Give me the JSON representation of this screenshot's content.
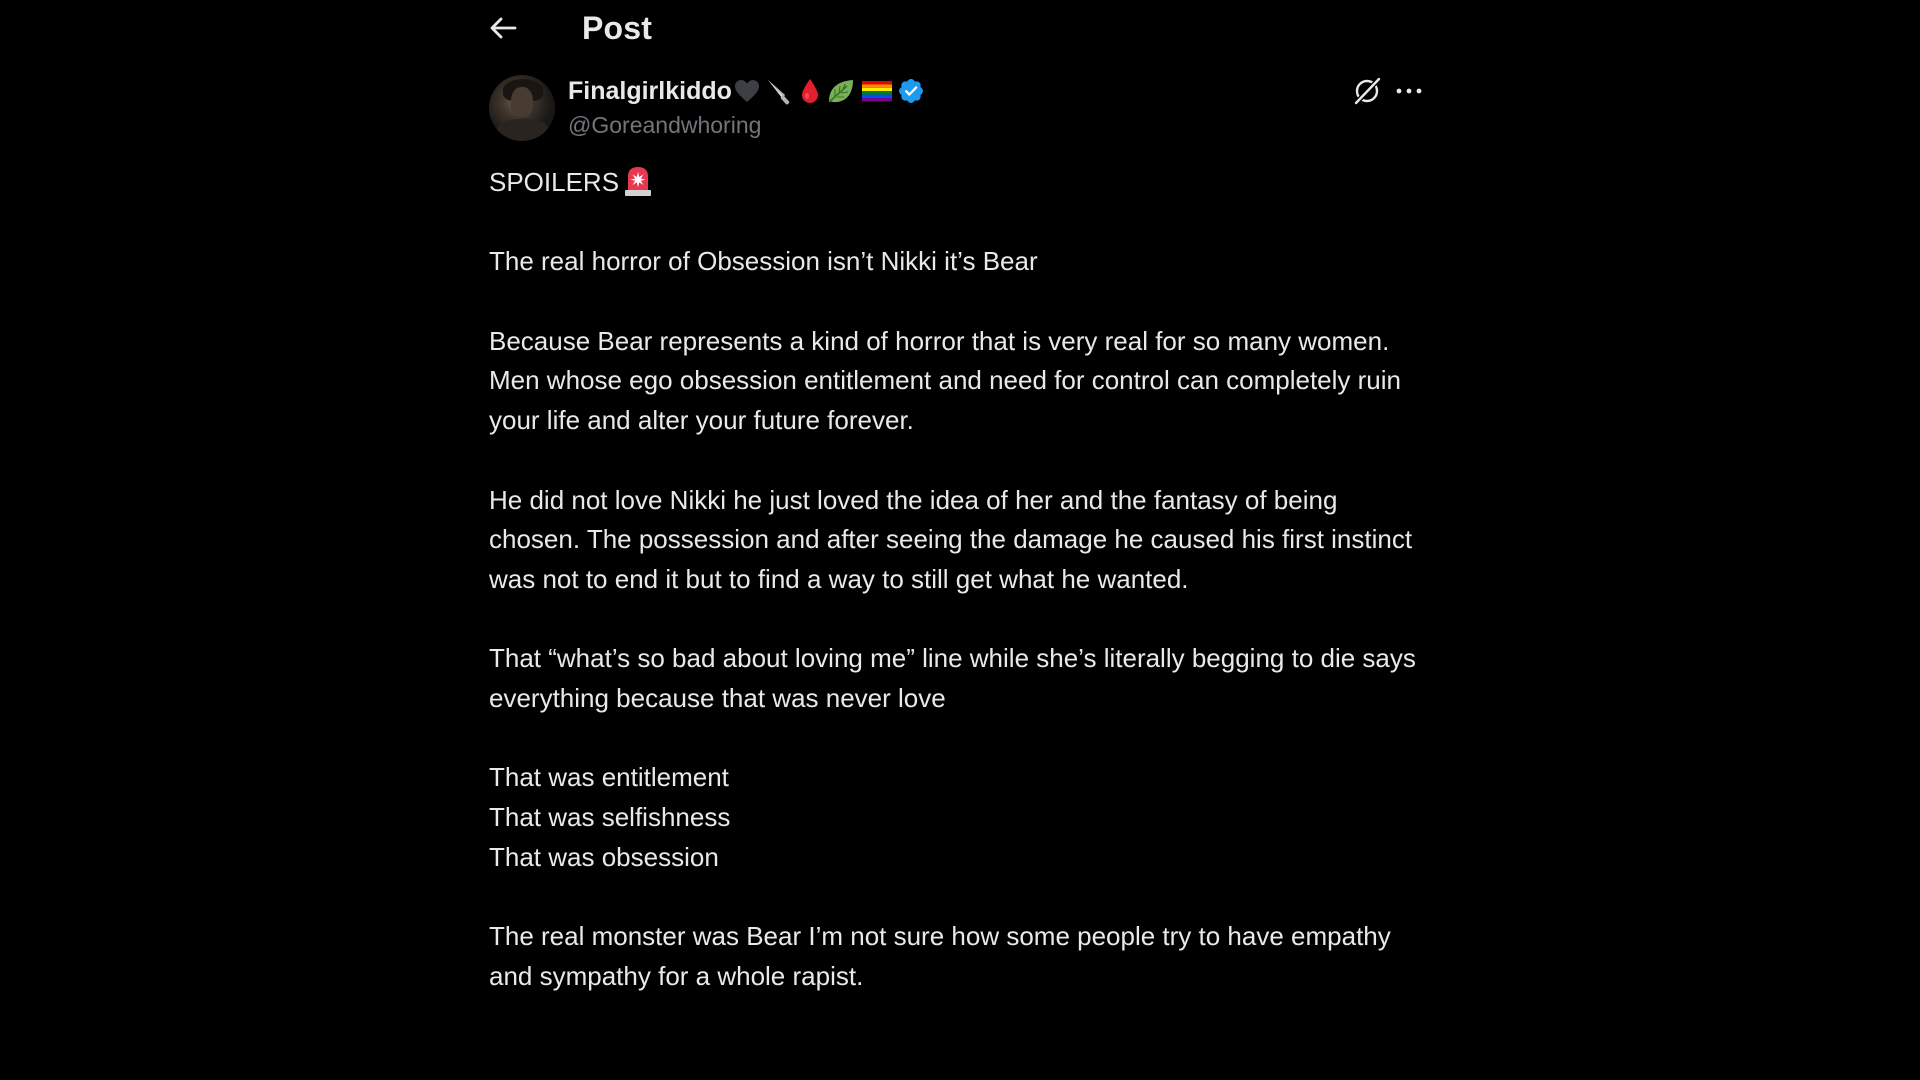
{
  "header": {
    "title": "Post"
  },
  "author": {
    "display_name": "Finalgirlkiddo",
    "name_emojis": [
      "black-heart-icon",
      "knife-icon",
      "blood-drop-icon",
      "leaf-icon",
      "rainbow-flag-icon",
      "verified-badge-icon"
    ],
    "handle": "@Goreandwhoring"
  },
  "actions": {
    "grok_icon": "grok-icon",
    "more_icon": "more-icon"
  },
  "post": {
    "spoiler_label": "SPOILERS",
    "spoiler_icon": "siren-icon",
    "paragraphs": [
      "The real horror of Obsession isn’t Nikki it’s Bear",
      "Because Bear represents a kind of horror that is very real for so many women. Men whose ego obsession entitlement and need for control can completely ruin your life and alter your future forever.",
      "He did not love Nikki he just loved the idea of her and the fantasy of being chosen.  The possession  and after seeing the damage he caused his first instinct was not to end it but to find a way to still get what he wanted.",
      "That “what’s so bad about loving me” line while she’s literally begging to die says everything because that was never love"
    ],
    "list_lines": [
      "That was entitlement",
      "That was selfishness",
      "That was obsession"
    ],
    "closing": "The real monster was Bear I’m not sure how some people try to have empathy and sympathy for a whole rapist."
  },
  "colors": {
    "background": "#000000",
    "text": "#e7e9ea",
    "secondary_text": "#71767b",
    "verified": "#1d9bf0"
  }
}
